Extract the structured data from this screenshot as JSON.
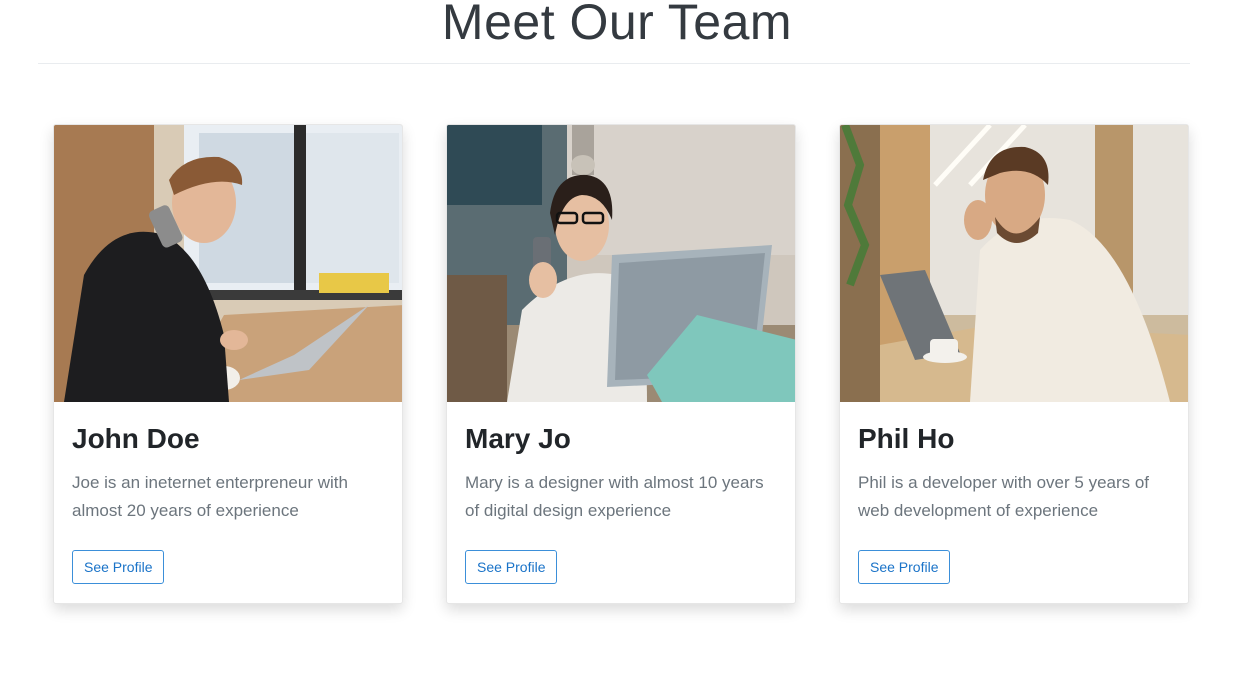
{
  "page": {
    "title": "Meet Our Team"
  },
  "team": [
    {
      "name": "John Doe",
      "bio": "Joe is an ineternet enterpreneur with almost 20 years of experience",
      "button_label": "See Profile"
    },
    {
      "name": "Mary Jo",
      "bio": "Mary is a designer with almost 10 years of digital design experience",
      "button_label": "See Profile"
    },
    {
      "name": "Phil Ho",
      "bio": "Phil is a developer with over 5 years of web development of experience",
      "button_label": "See Profile"
    }
  ],
  "colors": {
    "button_border": "#3b8fd9",
    "button_text": "#1a73c8",
    "bio_text": "#6c757d"
  }
}
